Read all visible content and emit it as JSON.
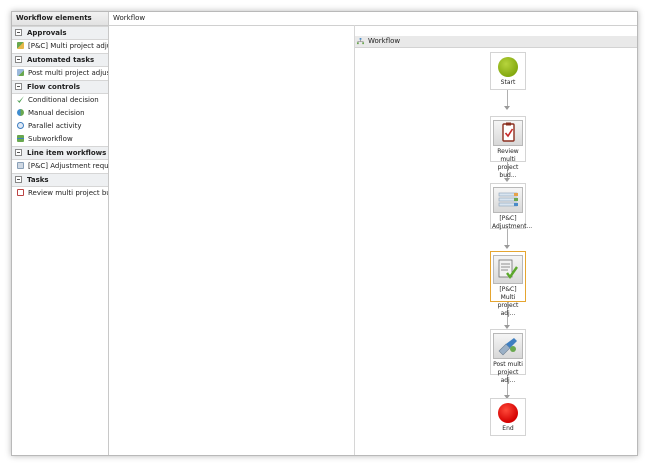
{
  "sidebar": {
    "title": "Workflow elements",
    "groups": [
      {
        "label": "Approvals",
        "items": [
          {
            "label": "[P&C] Multi project adjustment",
            "icon": "approval-icon"
          }
        ]
      },
      {
        "label": "Automated tasks",
        "items": [
          {
            "label": "Post multi project adjustment",
            "icon": "automated-task-icon"
          }
        ]
      },
      {
        "label": "Flow controls",
        "items": [
          {
            "label": "Conditional decision",
            "icon": "conditional-decision-icon"
          },
          {
            "label": "Manual decision",
            "icon": "manual-decision-icon"
          },
          {
            "label": "Parallel activity",
            "icon": "parallel-activity-icon"
          },
          {
            "label": "Subworkflow",
            "icon": "subworkflow-icon"
          }
        ]
      },
      {
        "label": "Line item workflows",
        "items": [
          {
            "label": "[P&C] Adjustment request app",
            "icon": "line-item-icon"
          }
        ]
      },
      {
        "label": "Tasks",
        "items": [
          {
            "label": "Review multi project budget a",
            "icon": "task-icon"
          }
        ]
      }
    ]
  },
  "workflow_header": {
    "title": "Workflow"
  },
  "diagram": {
    "title": "Workflow",
    "nodes": [
      {
        "label": "Start",
        "icon": "start-circle-icon"
      },
      {
        "label": "Review multi\nproject bud...",
        "icon": "clipboard-check-icon"
      },
      {
        "label": "[P&C]\nAdjustment...",
        "icon": "line-item-list-icon"
      },
      {
        "label": "[P&C] Multi\nproject adj...",
        "icon": "approval-check-icon",
        "selected": true
      },
      {
        "label": "Post multi\nproject adj...",
        "icon": "automated-task-icon"
      },
      {
        "label": "End",
        "icon": "end-circle-icon"
      }
    ]
  }
}
